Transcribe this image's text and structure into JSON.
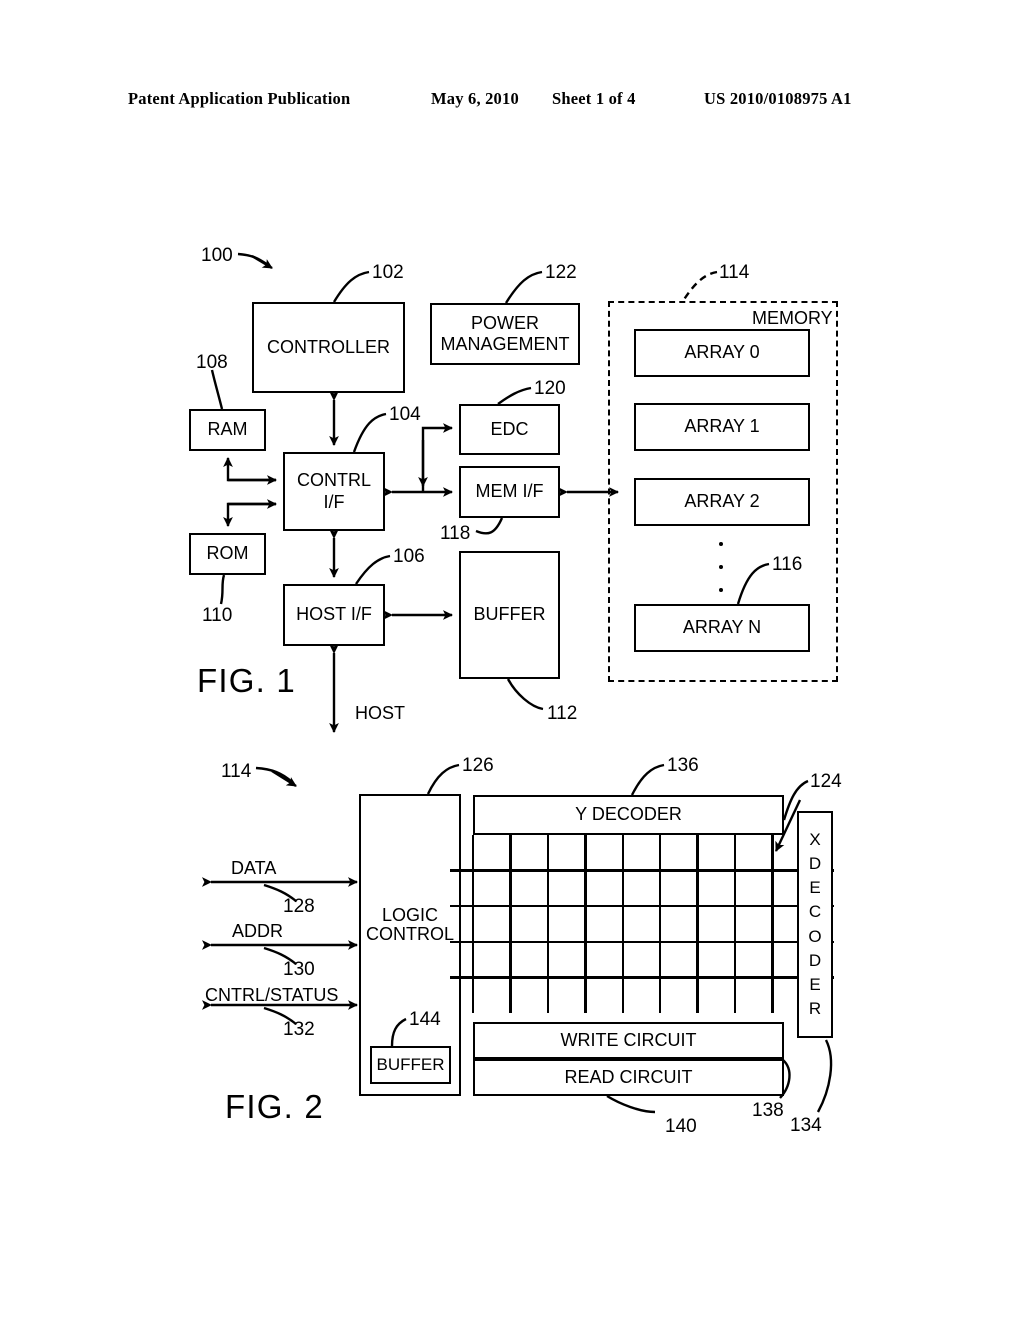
{
  "header": {
    "left": "Patent Application Publication",
    "date": "May 6, 2010",
    "sheet": "Sheet 1 of 4",
    "pubnum": "US 2010/0108975 A1"
  },
  "fig1": {
    "label": "FIG. 1",
    "system_ref": "100",
    "blocks": {
      "controller": "CONTROLLER",
      "power_management_line1": "POWER",
      "power_management_line2": "MANAGEMENT",
      "ram": "RAM",
      "rom": "ROM",
      "contrl_if_line1": "CONTRL",
      "contrl_if_line2": "I/F",
      "host_if": "HOST I/F",
      "edc": "EDC",
      "mem_if": "MEM I/F",
      "buffer": "BUFFER",
      "memory": "MEMORY",
      "array0": "ARRAY 0",
      "array1": "ARRAY 1",
      "array2": "ARRAY 2",
      "arrayn": "ARRAY N"
    },
    "signals": {
      "host": "HOST"
    },
    "refs": {
      "controller": "102",
      "power_management": "122",
      "memory": "114",
      "ram": "108",
      "contrl_if": "104",
      "edc": "120",
      "mem_if": "118",
      "rom": "110",
      "host_if": "106",
      "buffer": "112",
      "array_n": "116"
    }
  },
  "fig2": {
    "label": "FIG. 2",
    "array_ref": "114",
    "blocks": {
      "control_logic_line1": "CONTROL",
      "control_logic_line2": "LOGIC",
      "buffer": "BUFFER",
      "y_decoder": "Y DECODER",
      "x_decoder_letters": [
        "X",
        "D",
        "E",
        "C",
        "O",
        "D",
        "E",
        "R"
      ],
      "write_circuit": "WRITE CIRCUIT",
      "read_circuit": "READ CIRCUIT"
    },
    "signals": {
      "data": "DATA",
      "addr": "ADDR",
      "cntrl_status": "CNTRL/STATUS"
    },
    "refs": {
      "control_logic": "126",
      "y_decoder": "136",
      "cell": "124",
      "data": "128",
      "addr": "130",
      "cntrl_status": "132",
      "buffer": "144",
      "write_circuit": "138",
      "read_circuit": "140",
      "x_decoder": "134"
    },
    "grid": {
      "columns": 9,
      "rows": 5
    }
  },
  "colors": {
    "ink": "#000000",
    "paper": "#ffffff"
  }
}
